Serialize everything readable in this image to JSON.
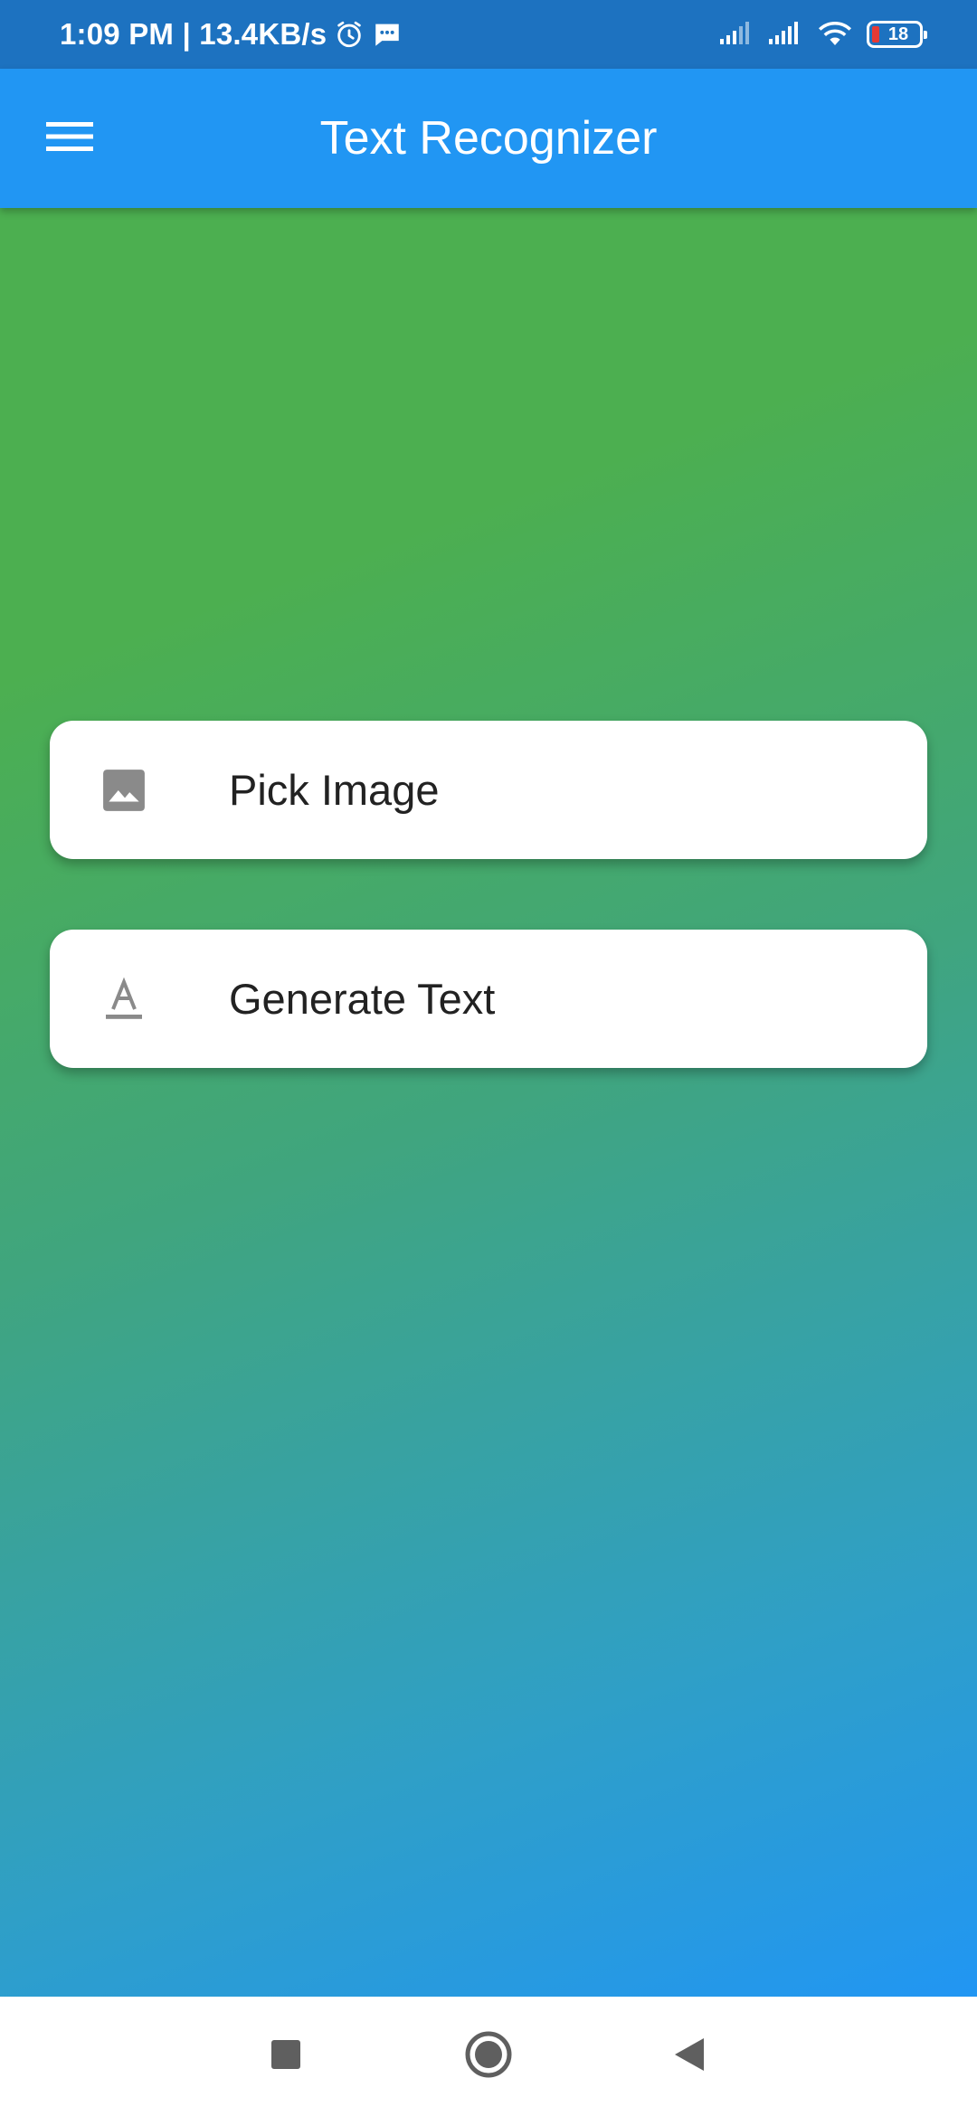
{
  "status_bar": {
    "time_speed": "1:09 PM | 13.4KB/s",
    "battery_level": "18",
    "icons": [
      "alarm-icon",
      "message-icon",
      "signal-icon",
      "signal-icon",
      "wifi-icon",
      "battery-icon"
    ]
  },
  "app_bar": {
    "title": "Text Recognizer",
    "menu_icon": "menu-icon"
  },
  "actions": [
    {
      "label": "Pick Image",
      "icon": "image-icon"
    },
    {
      "label": "Generate Text",
      "icon": "text-format-icon"
    }
  ],
  "nav_bar": {
    "buttons": [
      "recents-icon",
      "home-icon",
      "back-icon"
    ]
  },
  "colors": {
    "status_bar": "#1d72c0",
    "app_bar": "#2196f3",
    "gradient_start": "#4caf50",
    "gradient_end": "#2196f3",
    "card": "#ffffff",
    "card_text": "#222222",
    "icon_gray": "#8a8a8a",
    "nav_icon": "#5f5f5f"
  }
}
